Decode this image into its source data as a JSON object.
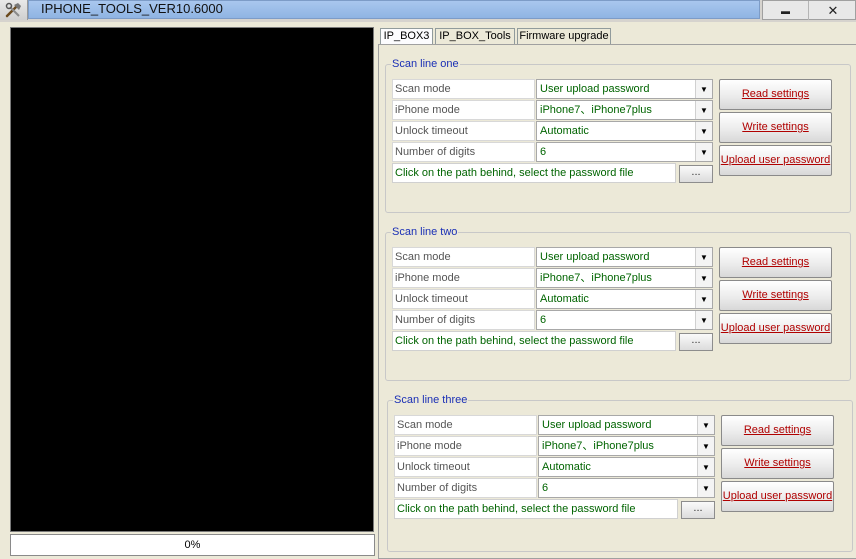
{
  "window": {
    "title": "IPHONE_TOOLS_VER10.6000",
    "app_icon": "tools-icon",
    "minimize_glyph": "▬",
    "close_glyph": "✕"
  },
  "progress": {
    "text": "0%"
  },
  "tabs": [
    {
      "label": "IP_BOX3",
      "active": true
    },
    {
      "label": "IP_BOX_Tools",
      "active": false
    },
    {
      "label": "Firmware upgrade",
      "active": false
    }
  ],
  "groups": [
    {
      "title": "Scan line one",
      "rows": [
        {
          "label": "Scan mode",
          "value": "User upload password"
        },
        {
          "label": "iPhone mode",
          "value": "iPhone7、iPhone7plus"
        },
        {
          "label": "Unlock timeout",
          "value": "Automatic"
        },
        {
          "label": "Number of digits",
          "value": "6"
        }
      ],
      "path": "Click on the path behind, select the password file",
      "browse": "...",
      "buttons": {
        "read": "Read settings",
        "write": "Write settings",
        "upload": "Upload user password"
      }
    },
    {
      "title": "Scan line two",
      "rows": [
        {
          "label": "Scan mode",
          "value": "User upload password"
        },
        {
          "label": "iPhone mode",
          "value": "iPhone7、iPhone7plus"
        },
        {
          "label": "Unlock timeout",
          "value": "Automatic"
        },
        {
          "label": "Number of digits",
          "value": "6"
        }
      ],
      "path": "Click on the path behind, select the password file",
      "browse": "...",
      "buttons": {
        "read": "Read settings",
        "write": "Write settings",
        "upload": "Upload user password"
      }
    },
    {
      "title": "Scan line three",
      "rows": [
        {
          "label": "Scan mode",
          "value": "User upload password"
        },
        {
          "label": "iPhone mode",
          "value": "iPhone7、iPhone7plus"
        },
        {
          "label": "Unlock timeout",
          "value": "Automatic"
        },
        {
          "label": "Number of digits",
          "value": "6"
        }
      ],
      "path": "Click on the path behind, select the password file",
      "browse": "...",
      "buttons": {
        "read": "Read settings",
        "write": "Write settings",
        "upload": "Upload user password"
      }
    }
  ]
}
